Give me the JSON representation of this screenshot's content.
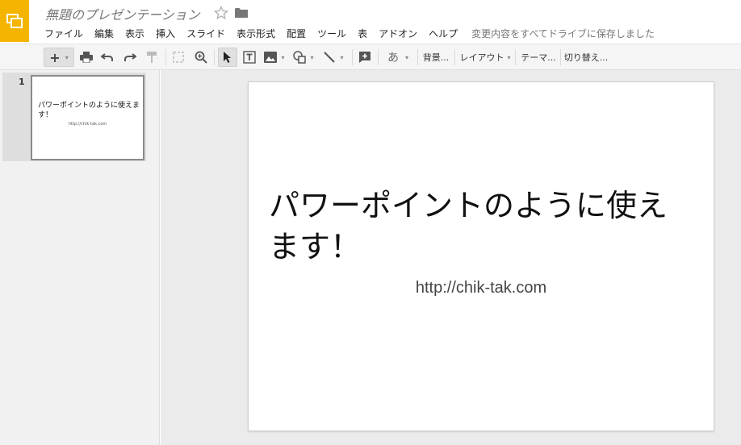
{
  "header": {
    "doc_title": "無題のプレゼンテーション",
    "brand_color": "#f4b400",
    "menu": [
      "ファイル",
      "編集",
      "表示",
      "挿入",
      "スライド",
      "表示形式",
      "配置",
      "ツール",
      "表",
      "アドオン",
      "ヘルプ"
    ],
    "save_status": "変更内容をすべてドライブに保存しました"
  },
  "toolbar": {
    "add_label": "+",
    "input_tools_label": "あ",
    "background_label": "背景...",
    "layout_label": "レイアウト",
    "theme_label": "テーマ...",
    "transition_label": "切り替え..."
  },
  "filmstrip": {
    "slides": [
      {
        "number": "1",
        "title": "パワーポイントのように使えます！",
        "subtitle": "http://chik-tak.com"
      }
    ]
  },
  "slide": {
    "title": "パワーポイントのように使えます！",
    "subtitle": "http://chik-tak.com"
  }
}
